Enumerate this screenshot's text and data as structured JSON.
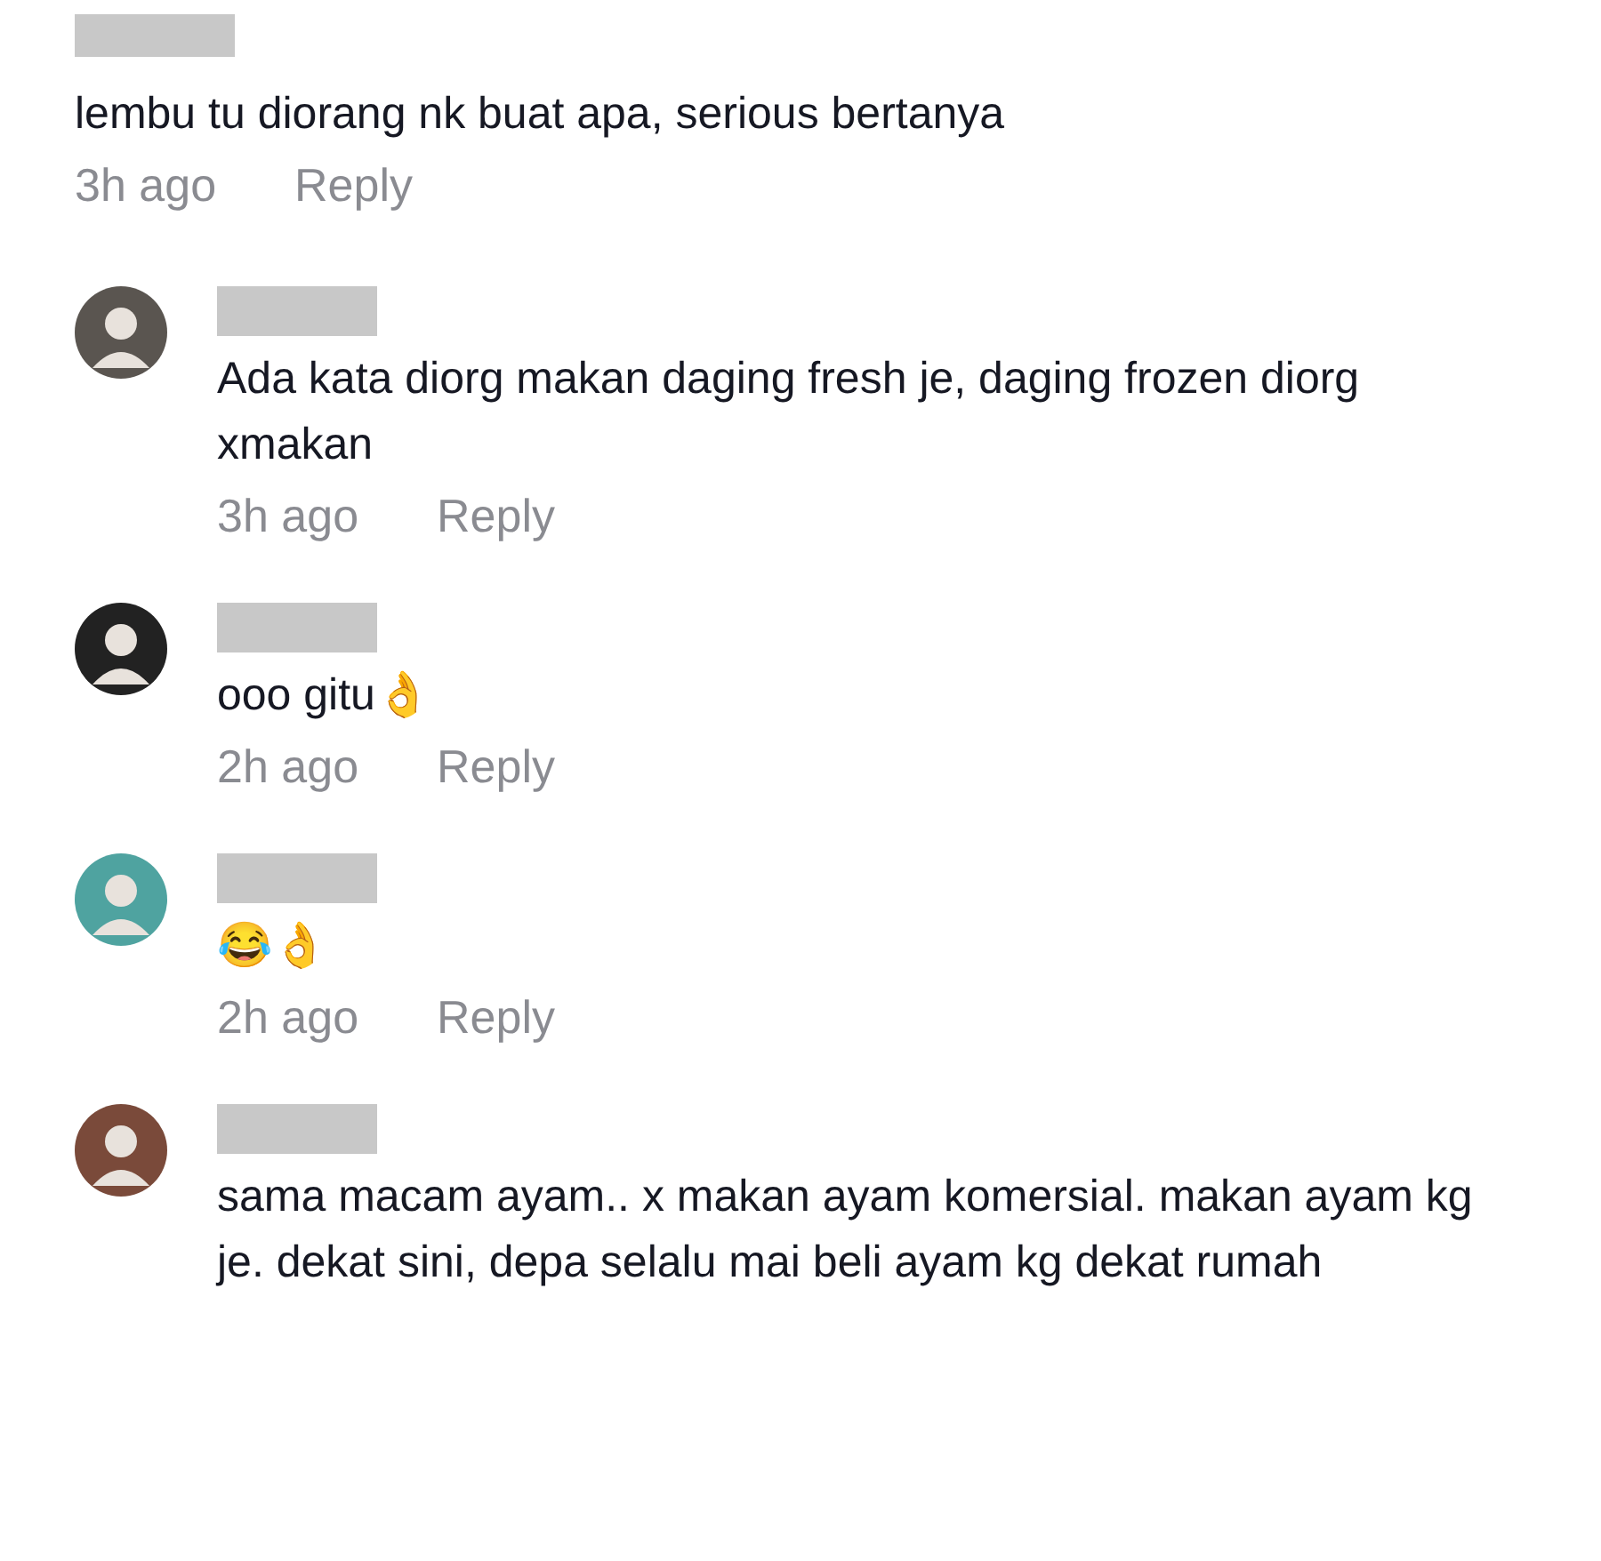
{
  "comment": {
    "name_hidden": true,
    "text": "lembu tu diorang nk buat apa, serious bertanya",
    "time": "3h ago",
    "reply_label": "Reply"
  },
  "replies": [
    {
      "name_hidden": true,
      "color": "#5a5550",
      "text": "Ada kata diorg makan daging fresh je, daging frozen diorg xmakan",
      "time": "3h ago",
      "reply_label": "Reply"
    },
    {
      "name_hidden": true,
      "color": "#222222",
      "text": "ooo gitu👌",
      "time": "2h ago",
      "reply_label": "Reply"
    },
    {
      "name_hidden": true,
      "color": "#4fa3a0",
      "text": "😂👌",
      "time": "2h ago",
      "reply_label": "Reply"
    },
    {
      "name_hidden": true,
      "color": "#7a4a3a",
      "text": "sama macam ayam.. x makan ayam komersial. makan ayam kg je. dekat sini, depa selalu mai beli ayam kg dekat rumah"
    }
  ]
}
